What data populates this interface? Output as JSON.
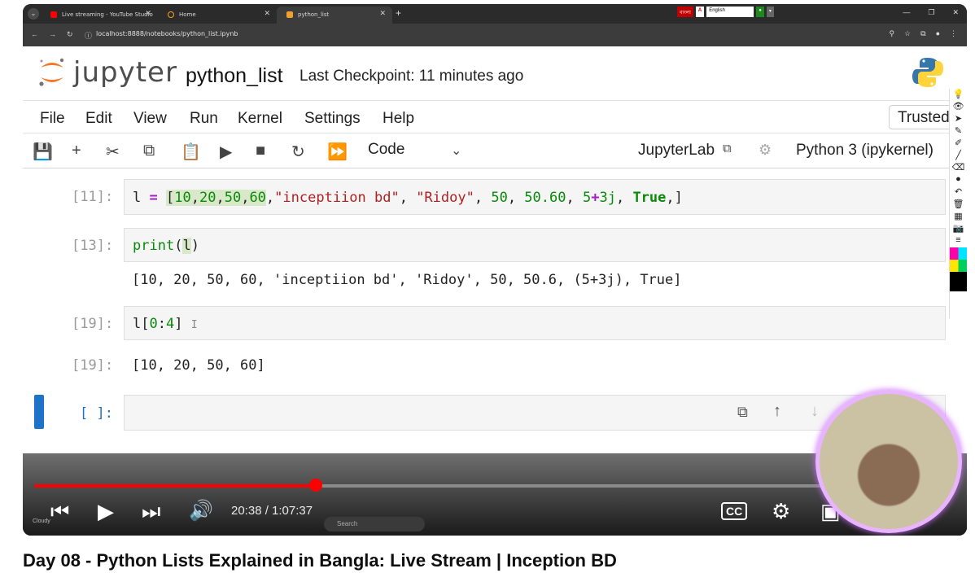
{
  "browser": {
    "tabs": [
      {
        "title": "Live streaming - YouTube Studio",
        "active": false
      },
      {
        "title": "Home",
        "active": false
      },
      {
        "title": "python_list",
        "active": true
      }
    ],
    "lang_label": "বাংলা",
    "lang_select": "English",
    "url": "localhost:8888/notebooks/python_list.ipynb"
  },
  "jupyter": {
    "brand": "jupyter",
    "notebook_name": "python_list",
    "checkpoint": "Last Checkpoint: 11 minutes ago",
    "menus": [
      "File",
      "Edit",
      "View",
      "Run",
      "Kernel",
      "Settings",
      "Help"
    ],
    "trusted": "Trusted",
    "cell_type": "Code",
    "jupyterlab_link": "JupyterLab",
    "kernel": "Python 3 (ipykernel)",
    "cells": [
      {
        "prompt": "[11]:",
        "output": ""
      },
      {
        "prompt": "[13]:",
        "output": "[10, 20, 50, 60, 'inceptiion bd', 'Ridoy', 50, 50.6, (5+3j), True]"
      },
      {
        "prompt": "[19]:",
        "output_prompt": "[19]:",
        "output": "[10, 20, 50, 60]"
      },
      {
        "prompt": "[ ]:",
        "output": ""
      }
    ]
  },
  "video": {
    "time": "20:38 / 1:07:37",
    "progress": 0.306,
    "accent": "#ff0000",
    "taskbar_search": "Search",
    "weather": "Cloudy"
  },
  "page": {
    "video_title": "Day 08 - Python Lists Explained in Bangla: Live Stream | Inception BD"
  }
}
